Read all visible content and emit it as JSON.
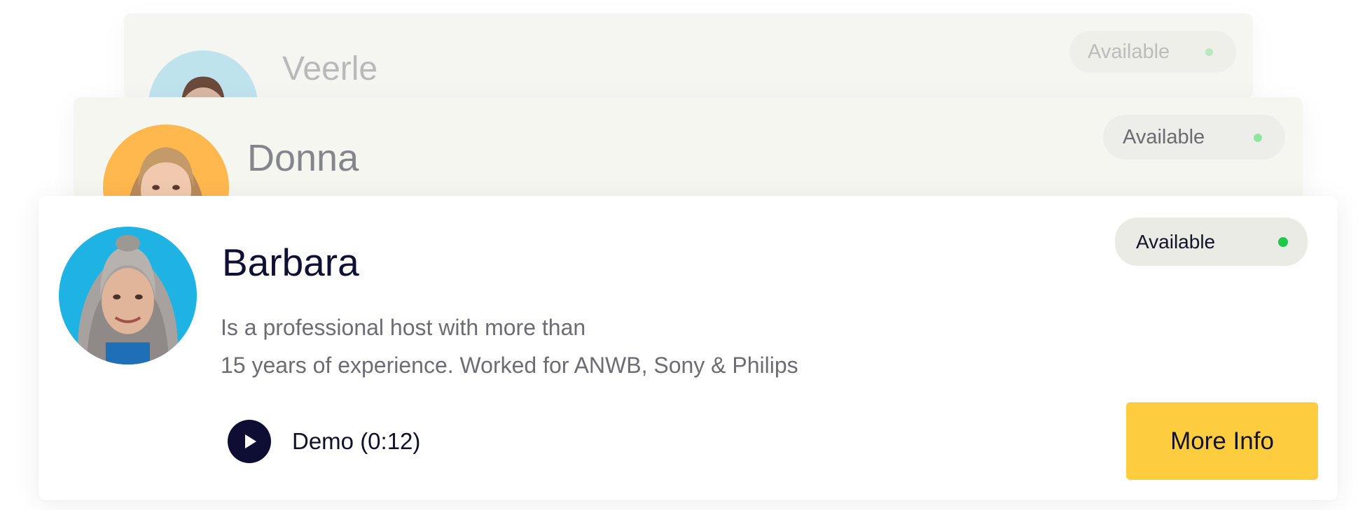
{
  "hosts": [
    {
      "name": "Veerle",
      "status": "Available",
      "avatar_icon": "portrait-veerle",
      "avatar_bg": "#bfe3ec",
      "status_dot_color": "#b7e8bf"
    },
    {
      "name": "Donna",
      "status": "Available",
      "avatar_icon": "portrait-donna",
      "avatar_bg": "#ffb84d",
      "status_dot_color": "#8fe6a0"
    },
    {
      "name": "Barbara",
      "status": "Available",
      "avatar_icon": "portrait-barbara",
      "avatar_bg": "#1eb3e3",
      "status_dot_color": "#1ec94a",
      "bio_lines": [
        "Is a professional host with more than",
        "15 years of experience. Worked for ANWB, Sony & Philips"
      ],
      "demo_label": "Demo (0:12)",
      "demo_icon": "play-icon",
      "more_info_label": "More Info"
    }
  ],
  "colors": {
    "accent_button": "#fecd3f",
    "primary_text": "#101034",
    "play_button": "#0e0d34"
  }
}
